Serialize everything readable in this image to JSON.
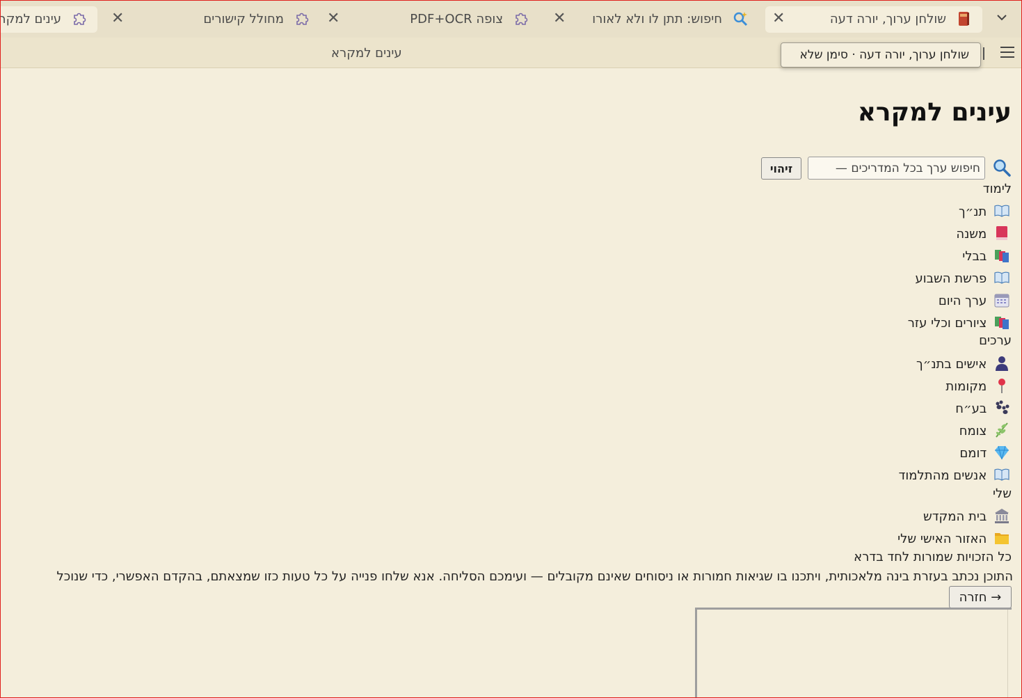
{
  "tabs": [
    {
      "title": "שולחן ערוך, יורה דעה",
      "icon": "book-icon"
    },
    {
      "title": "חיפוש: תתן לו ולא לאורו",
      "icon": "search-sparkle-icon"
    },
    {
      "title": "צופה PDF+OCR",
      "icon": "puzzle-icon"
    },
    {
      "title": "מחולל קישורים",
      "icon": "puzzle-icon"
    },
    {
      "title": "עינים למקרא",
      "icon": "puzzle-icon"
    }
  ],
  "toolbar": {
    "page_title": "עינים למקרא",
    "tooltip": "שולחן ערוך, יורה דעה · סימן שלא"
  },
  "content": {
    "heading": "עינים למקרא",
    "search": {
      "placeholder": "חיפוש ערך בכל המדריכים —",
      "identify_label": "זיהוי"
    },
    "sections": [
      {
        "title": "לימוד",
        "items": [
          {
            "label": "תנ״ך",
            "icon": "open-book-icon"
          },
          {
            "label": "משנה",
            "icon": "red-book-icon"
          },
          {
            "label": "בבלי",
            "icon": "books-icon"
          },
          {
            "label": "פרשת השבוע",
            "icon": "open-book-icon"
          },
          {
            "label": "ערך היום",
            "icon": "calendar-icon"
          },
          {
            "label": "ציורים וכלי עזר",
            "icon": "books-icon"
          }
        ]
      },
      {
        "title": "ערכים",
        "items": [
          {
            "label": "אישים בתנ״ך",
            "icon": "person-icon"
          },
          {
            "label": "מקומות",
            "icon": "pin-icon"
          },
          {
            "label": "בע״ח",
            "icon": "paw-icon"
          },
          {
            "label": "צומח",
            "icon": "herb-icon"
          },
          {
            "label": "דומם",
            "icon": "gem-icon"
          },
          {
            "label": "אנשים מהתלמוד",
            "icon": "open-book-icon"
          }
        ]
      },
      {
        "title": "שלי",
        "items": [
          {
            "label": "בית המקדש",
            "icon": "temple-icon"
          },
          {
            "label": "האזור האישי שלי",
            "icon": "folder-icon"
          }
        ]
      }
    ],
    "rights": "כל הזכויות שמורות לחד בדרא",
    "disclaimer": "התוכן נכתב בעזרת בינה מלאכותית, ויתכנו בו שגיאות חמורות או ניסוחים שאינם מקובלים — ועימכם הסליחה. אנא שלחו פנייה על כל טעות כזו שמצאתם, בהקדם האפשרי, כדי שנוכל",
    "back_label": "→ חזרה"
  },
  "colors": {
    "background": "#f4eedc",
    "tabbar": "#e8e0c9",
    "border_accent": "#e0201c"
  }
}
